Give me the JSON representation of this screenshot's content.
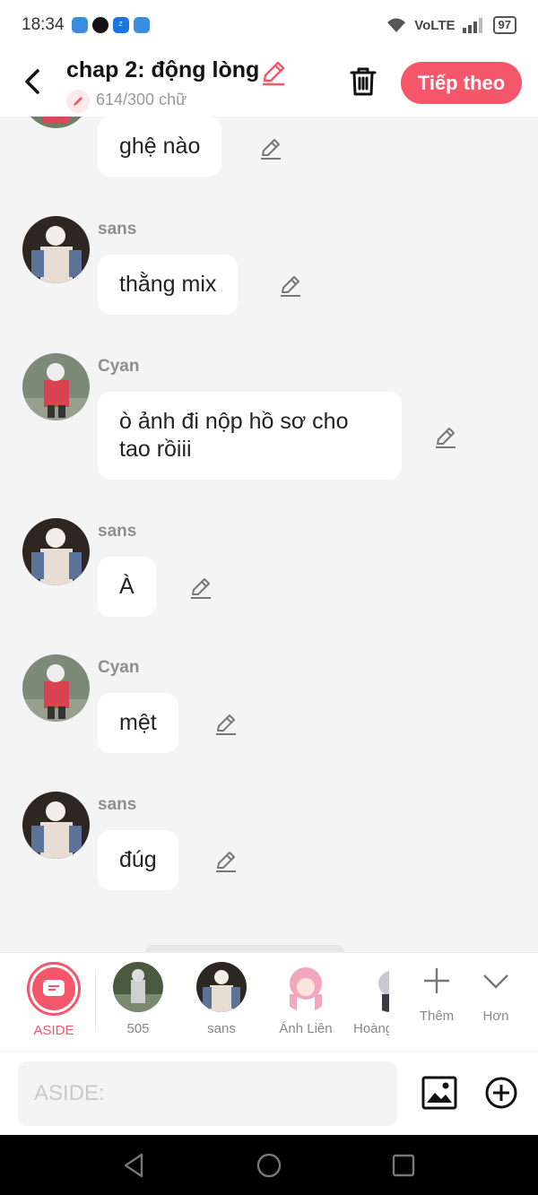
{
  "status_bar": {
    "time": "18:34",
    "network": "VoLTE",
    "battery": "97"
  },
  "header": {
    "title": "chap 2: động lòng",
    "word_count": "614/300 chữ",
    "next_label": "Tiếp theo"
  },
  "messages": [
    {
      "sender": "",
      "text": "ghệ nào"
    },
    {
      "sender": "sans",
      "text": "thằng mix"
    },
    {
      "sender": "Cyan",
      "text": "ò ảnh đi nộp hồ sơ cho tao rồiii"
    },
    {
      "sender": "sans",
      "text": "À"
    },
    {
      "sender": "Cyan",
      "text": "mệt"
    },
    {
      "sender": "sans",
      "text": "đúg"
    }
  ],
  "characters": [
    {
      "name": "ASIDE"
    },
    {
      "name": "505"
    },
    {
      "name": "sans"
    },
    {
      "name": "Ánh Liên"
    },
    {
      "name": "Hoàng"
    }
  ],
  "actions": {
    "more_label": "Thêm",
    "less_label": "Hơn"
  },
  "input": {
    "placeholder": "ASIDE:"
  },
  "colors": {
    "accent": "#f6566a",
    "background": "#f4f4f4"
  }
}
